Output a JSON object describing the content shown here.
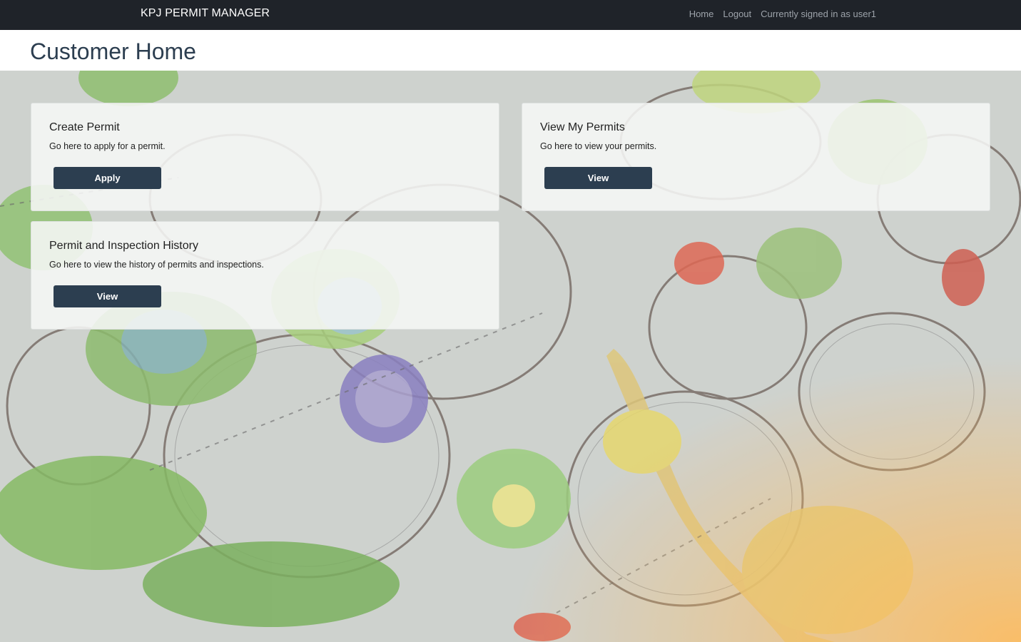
{
  "navbar": {
    "brand": "KPJ PERMIT MANAGER",
    "links": [
      "Home",
      "Logout"
    ],
    "user_text": "Currently signed in as user1"
  },
  "header": {
    "title": "Customer Home"
  },
  "cards": [
    {
      "title": "Create Permit",
      "text": "Go here to apply for a permit.",
      "button": "Apply"
    },
    {
      "title": "View My Permits",
      "text": "Go here to view your permits.",
      "button": "View"
    },
    {
      "title": "Permit and Inspection History",
      "text": "Go here to view the history of permits and inspections.",
      "button": "View"
    }
  ],
  "colors": {
    "navbar_bg": "#1f2329",
    "title_color": "#2c3e50",
    "button_bg": "#2c3e50"
  }
}
